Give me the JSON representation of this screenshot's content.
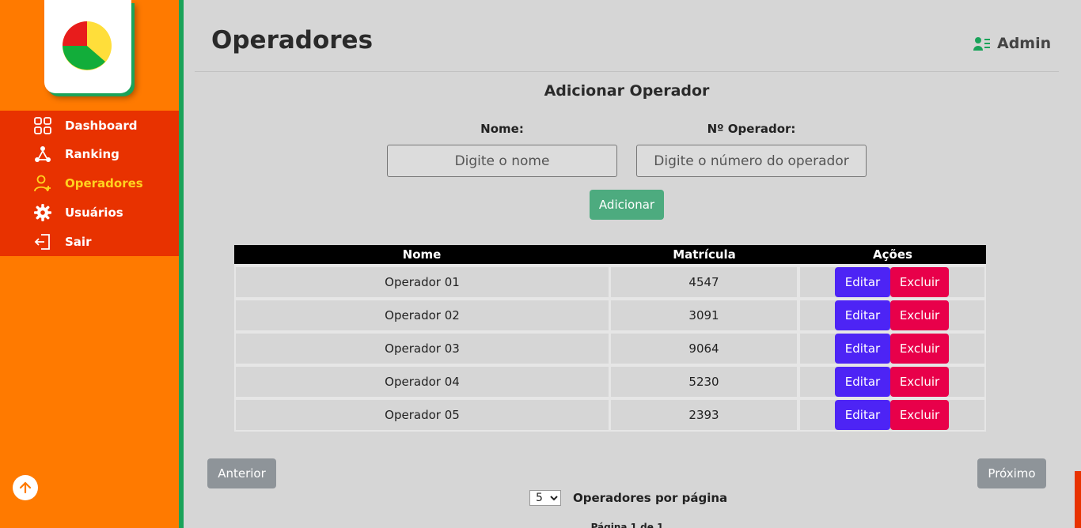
{
  "sidebar": {
    "logo": "pie-chart-logo",
    "items": [
      {
        "label": "Dashboard",
        "icon": "dashboard-grid-icon"
      },
      {
        "label": "Ranking",
        "icon": "ranking-icon"
      },
      {
        "label": "Operadores",
        "icon": "user-add-icon",
        "active": true
      },
      {
        "label": "Usuários",
        "icon": "gear-icon"
      },
      {
        "label": "Sair",
        "icon": "logout-icon"
      }
    ],
    "scroll_top_icon": "arrow-up-icon"
  },
  "header": {
    "title": "Operadores",
    "user_label": "Admin",
    "user_icon": "user-list-icon"
  },
  "form": {
    "title": "Adicionar Operador",
    "name_label": "Nome:",
    "name_placeholder": "Digite o nome",
    "number_label": "Nº Operador:",
    "number_placeholder": "Digite o número do operador",
    "add_label": "Adicionar"
  },
  "table": {
    "headers": [
      "Nome",
      "Matrícula",
      "Ações"
    ],
    "rows": [
      {
        "name": "Operador 01",
        "id": "4547"
      },
      {
        "name": "Operador 02",
        "id": "3091"
      },
      {
        "name": "Operador 03",
        "id": "9064"
      },
      {
        "name": "Operador 04",
        "id": "5230"
      },
      {
        "name": "Operador 05",
        "id": "2393"
      }
    ],
    "edit_label": "Editar",
    "delete_label": "Excluir"
  },
  "pagination": {
    "prev_label": "Anterior",
    "next_label": "Próximo",
    "per_page_value": "5",
    "per_page_label": "Operadores por página",
    "page_info": "Página 1 de 1"
  },
  "colors": {
    "sidebar": "#ff7a00",
    "nav": "#e83200",
    "accent_green": "#1aa35a",
    "edit": "#4d24f5",
    "delete": "#e8004a",
    "add": "#4dab7f",
    "active_nav": "#ffd21f"
  }
}
